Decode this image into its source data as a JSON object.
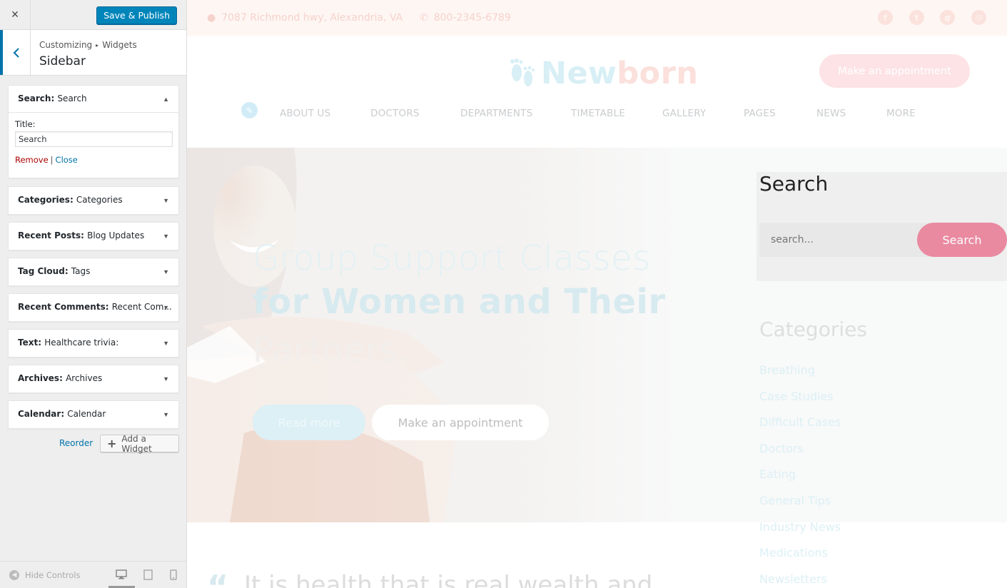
{
  "customizer": {
    "close_label": "×",
    "publish_label": "Save & Publish",
    "breadcrumb": {
      "root": "Customizing",
      "separator": "▸",
      "current": "Widgets"
    },
    "section_title": "Sidebar",
    "widgets": [
      {
        "type": "Search",
        "title": "Search",
        "open": true
      },
      {
        "type": "Categories",
        "title": "Categories",
        "open": false
      },
      {
        "type": "Recent Posts",
        "title": "Blog Updates",
        "open": false
      },
      {
        "type": "Tag Cloud",
        "title": "Tags",
        "open": false
      },
      {
        "type": "Recent Comments",
        "title": "Recent Com...",
        "open": false
      },
      {
        "type": "Text",
        "title": "Healthcare trivia:",
        "open": false
      },
      {
        "type": "Archives",
        "title": "Archives",
        "open": false
      },
      {
        "type": "Calendar",
        "title": "Calendar",
        "open": false
      }
    ],
    "separator": ": ",
    "search_widget_form": {
      "title_label": "Title:",
      "title_value": "Search",
      "remove_label": "Remove",
      "divider": "|",
      "close_label": "Close"
    },
    "reorder_label": "Reorder",
    "add_widget_label": "Add a Widget",
    "hide_controls_label": "Hide Controls",
    "accent_color": "#0073aa",
    "publish_color": "#0085ba"
  },
  "site": {
    "topbar": {
      "address": "7087 Richmond hwy, Alexandria, VA",
      "phone": "800-2345-6789",
      "social_icons": [
        "facebook-icon",
        "twitter-icon",
        "google-plus-icon",
        "instagram-icon"
      ]
    },
    "logo": {
      "part1": "New",
      "part2": "born"
    },
    "appointment_button": "Make an appointment",
    "nav": [
      "ABOUT US",
      "DOCTORS",
      "DEPARTMENTS",
      "TIMETABLE",
      "GALLERY",
      "PAGES",
      "NEWS",
      "MORE"
    ],
    "hero": {
      "line1": "Group Support Classes",
      "line2": "for Women and Their",
      "line3": "Partners...",
      "button1": "Read more",
      "button2": "Make an appointment"
    },
    "sidebar": {
      "search_title": "Search",
      "search_placeholder": "search...",
      "search_button": "Search",
      "categories_title": "Categories",
      "categories": [
        "Breathing",
        "Case Studies",
        "Difficult Cases",
        "Doctors",
        "Eating",
        "General Tips",
        "Industry News",
        "Medications",
        "Newsletters"
      ]
    },
    "quote": "It is health that is real wealth and",
    "brand_pink": "#e98aa0",
    "brand_blue": "#d7eff5"
  }
}
